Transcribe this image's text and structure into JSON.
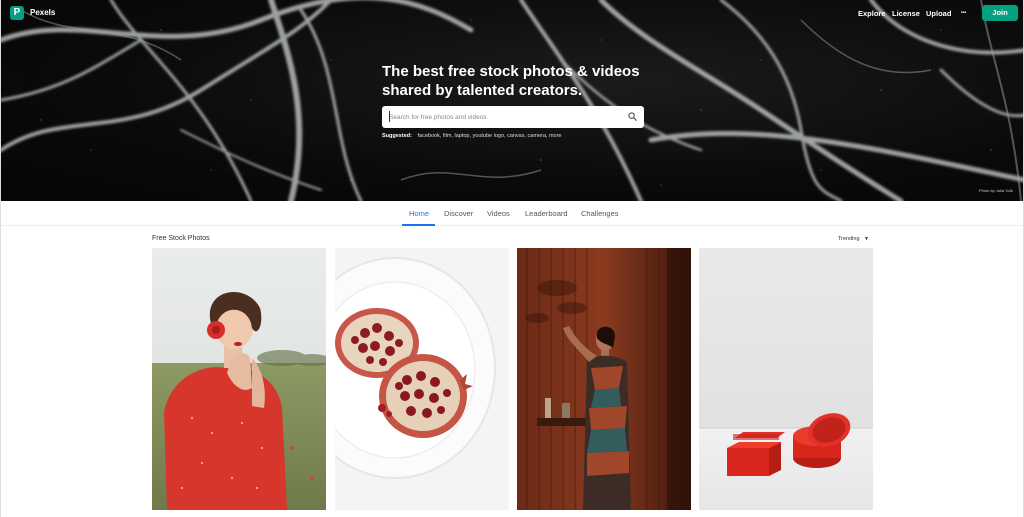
{
  "header": {
    "brand": "Pexels",
    "nav": [
      "Explore",
      "License",
      "Upload"
    ],
    "more_label": "•••",
    "join_label": "Join"
  },
  "hero": {
    "headline_line1": "The best free stock photos & videos",
    "headline_line2": "shared by talented creators.",
    "search_placeholder": "Search for free photos and videos",
    "suggested_label": "Suggested:",
    "suggested_tags": "facebook, film, laptop, youtube logo, canvas, camera, more",
    "credit": "Photo by Julia Volk"
  },
  "tabs": [
    "Home",
    "Discover",
    "Videos",
    "Leaderboard",
    "Challenges"
  ],
  "section": {
    "title": "Free Stock Photos",
    "sort_label": "Trending"
  },
  "colors": {
    "brand": "#05a081",
    "tab_active": "#1a73e8"
  }
}
